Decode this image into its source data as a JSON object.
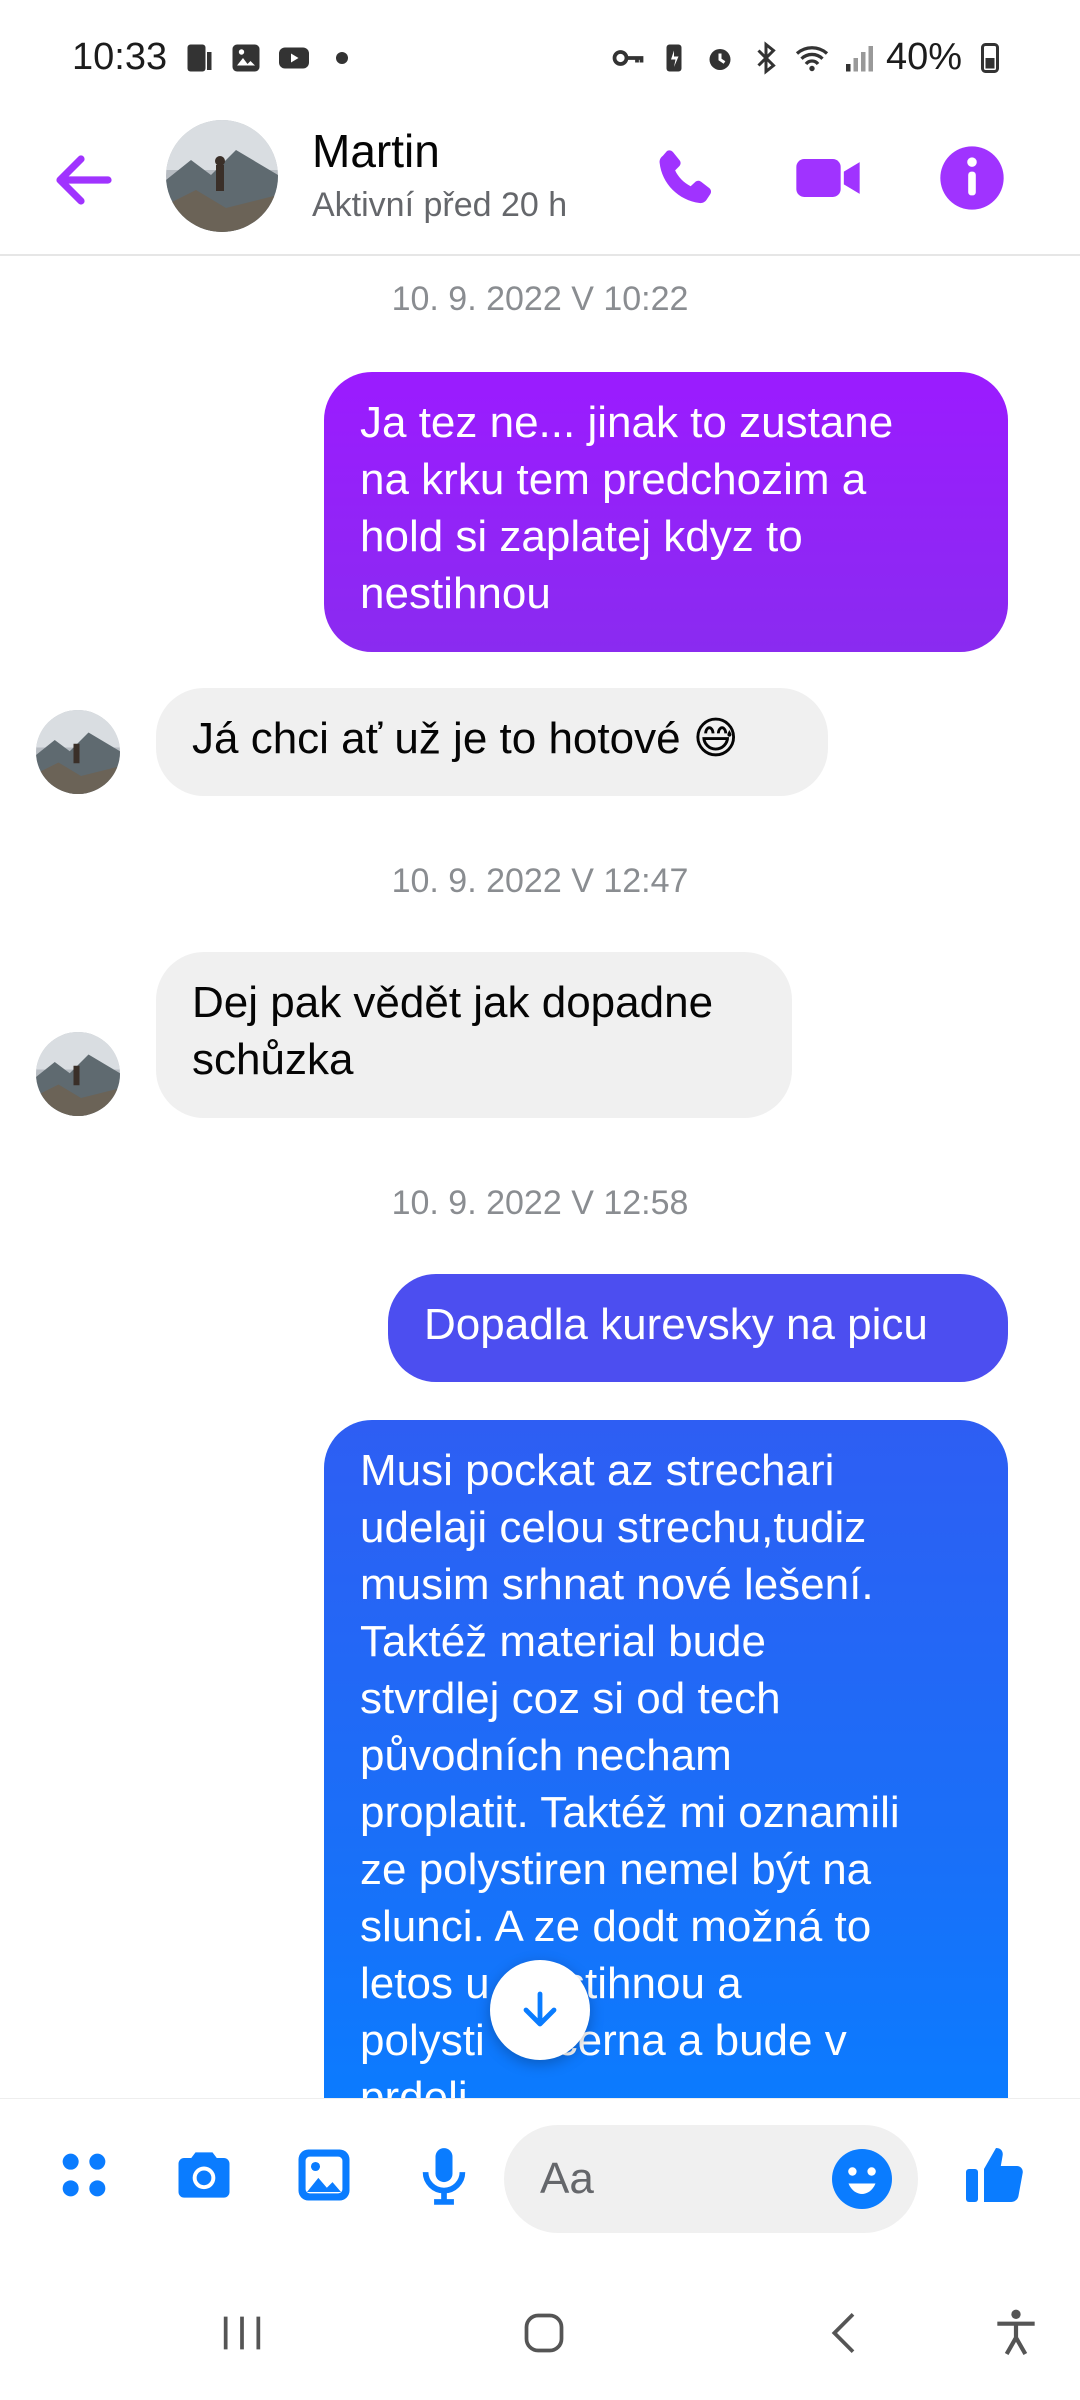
{
  "status_bar": {
    "time": "10:33",
    "battery": "40%"
  },
  "header": {
    "contact_name": "Martin",
    "contact_status": "Aktivní před 20 h"
  },
  "messages": [
    {
      "type": "timestamp",
      "text": "10. 9. 2022 V 10:22"
    },
    {
      "type": "outgoing",
      "lines": [
        "Ja tez ne...  jinak to zustane",
        "na krku tem predchozim a",
        "hold si zaplatej kdyz to",
        "nestihnou"
      ]
    },
    {
      "type": "incoming",
      "text": "Já chci ať už je to hotové",
      "emoji": "😅"
    },
    {
      "type": "timestamp",
      "text": "10. 9. 2022 V 12:47"
    },
    {
      "type": "incoming",
      "lines": [
        "Dej pak vědět jak dopadne",
        "schůzka"
      ]
    },
    {
      "type": "timestamp",
      "text": "10. 9. 2022 V 12:58"
    },
    {
      "type": "outgoing",
      "text": "Dopadla kurevsky na picu"
    },
    {
      "type": "outgoing",
      "lines": [
        "Musi pockat az strechari",
        "udelaji celou strechu,tudiz",
        "musim srhnat nové lešení.",
        "Taktéž material bude",
        "stvrdlej coz si od tech",
        "původních necham",
        "proplatit. Taktéž mi oznamili",
        "ze polystiren nemel být na",
        "slunci. A ze dodt možná to",
        "letos u  nestihnou a",
        "polysti    zcerna a bude v",
        "prdeli"
      ]
    }
  ],
  "composer": {
    "placeholder": "Aa"
  },
  "colors": {
    "accent_purple": "#a033ff",
    "messenger_blue": "#0a7cff",
    "gradient_purple_top": "#9b1bff",
    "gradient_purple_bottom": "#8a2bf0",
    "gradient_indigo": "#4c4ef0",
    "gradient_blue": "#1874f6",
    "composer_blue": "#0a7cff"
  },
  "icons": {
    "header": [
      "back-arrow-icon",
      "phone-icon",
      "video-camera-icon",
      "info-icon"
    ],
    "composer": [
      "apps-grid-icon",
      "camera-icon",
      "gallery-icon",
      "microphone-icon",
      "emoji-icon",
      "thumbs-up-icon"
    ],
    "nav": [
      "recent-apps-icon",
      "home-icon",
      "back-icon",
      "accessibility-icon"
    ]
  }
}
